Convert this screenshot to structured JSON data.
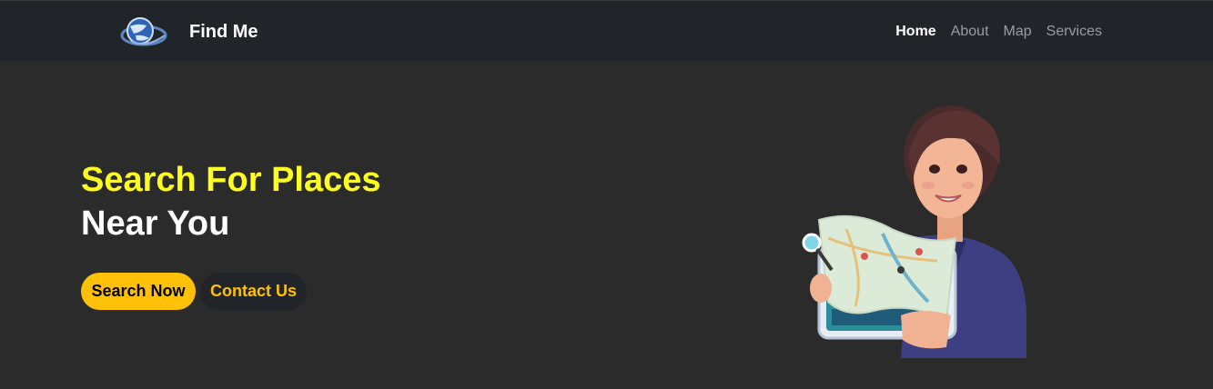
{
  "brand": {
    "name": "Find Me",
    "logo_icon": "globe-logo-icon"
  },
  "nav": {
    "items": [
      {
        "label": "Home",
        "active": true
      },
      {
        "label": "About",
        "active": false
      },
      {
        "label": "Map",
        "active": false
      },
      {
        "label": "Services",
        "active": false
      }
    ]
  },
  "hero": {
    "title_line1": "Search For Places",
    "title_line2": "Near You",
    "primary_button": "Search Now",
    "secondary_button": "Contact Us",
    "illustration": "woman-holding-map-illustration"
  },
  "colors": {
    "navbar_bg": "#212529",
    "page_bg": "#2b2b2b",
    "highlight_yellow": "#ffff1f",
    "button_yellow": "#ffc107"
  }
}
